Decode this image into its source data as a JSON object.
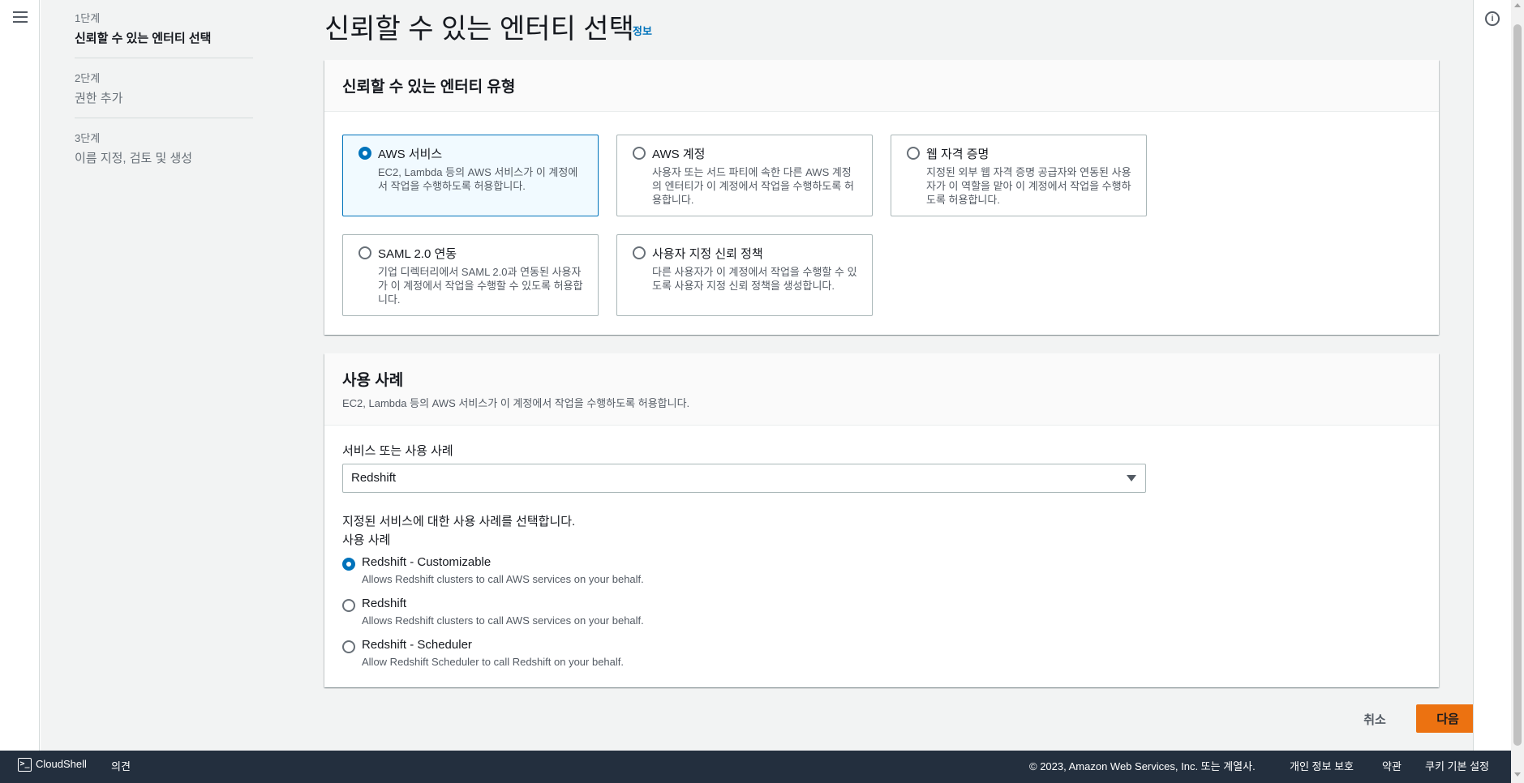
{
  "steps": [
    {
      "num": "1단계",
      "title": "신뢰할 수 있는 엔터티 선택"
    },
    {
      "num": "2단계",
      "title": "권한 추가"
    },
    {
      "num": "3단계",
      "title": "이름 지정, 검토 및 생성"
    }
  ],
  "page": {
    "title": "신뢰할 수 있는 엔터티 선택",
    "info_link": "정보"
  },
  "trusted_entity": {
    "heading": "신뢰할 수 있는 엔터티 유형",
    "options": [
      {
        "title": "AWS 서비스",
        "desc": "EC2, Lambda 등의 AWS 서비스가 이 계정에서 작업을 수행하도록 허용합니다.",
        "selected": true
      },
      {
        "title": "AWS 계정",
        "desc": "사용자 또는 서드 파티에 속한 다른 AWS 계정의 엔터티가 이 계정에서 작업을 수행하도록 허용합니다.",
        "selected": false
      },
      {
        "title": "웹 자격 증명",
        "desc": "지정된 외부 웹 자격 증명 공급자와 연동된 사용자가 이 역할을 맡아 이 계정에서 작업을 수행하도록 허용합니다.",
        "selected": false
      },
      {
        "title": "SAML 2.0 연동",
        "desc": "기업 디렉터리에서 SAML 2.0과 연동된 사용자가 이 계정에서 작업을 수행할 수 있도록 허용합니다.",
        "selected": false
      },
      {
        "title": "사용자 지정 신뢰 정책",
        "desc": "다른 사용자가 이 계정에서 작업을 수행할 수 있도록 사용자 지정 신뢰 정책을 생성합니다.",
        "selected": false
      }
    ]
  },
  "use_case": {
    "heading": "사용 사례",
    "description": "EC2, Lambda 등의 AWS 서비스가 이 계정에서 작업을 수행하도록 허용합니다.",
    "service_label": "서비스 또는 사용 사례",
    "service_value": "Redshift",
    "choose_text": "지정된 서비스에 대한 사용 사례를 선택합니다.",
    "use_case_label": "사용 사례",
    "options": [
      {
        "title": "Redshift - Customizable",
        "desc": "Allows Redshift clusters to call AWS services on your behalf.",
        "selected": true
      },
      {
        "title": "Redshift",
        "desc": "Allows Redshift clusters to call AWS services on your behalf.",
        "selected": false
      },
      {
        "title": "Redshift - Scheduler",
        "desc": "Allow Redshift Scheduler to call Redshift on your behalf.",
        "selected": false
      }
    ]
  },
  "actions": {
    "cancel": "취소",
    "next": "다음"
  },
  "footer": {
    "cloudshell": "CloudShell",
    "feedback": "의견",
    "copyright": "© 2023, Amazon Web Services, Inc. 또는 계열사.",
    "privacy": "개인 정보 보호",
    "terms": "약관",
    "cookies": "쿠키 기본 설정"
  },
  "colors": {
    "accent": "#0073bb",
    "primary_button": "#ec7211",
    "footer_bg": "#232f3e"
  },
  "icons": {
    "menu": "hamburger-menu-icon",
    "info": "info-circle-icon",
    "dropdown": "caret-down-icon",
    "cloudshell": "terminal-icon"
  }
}
